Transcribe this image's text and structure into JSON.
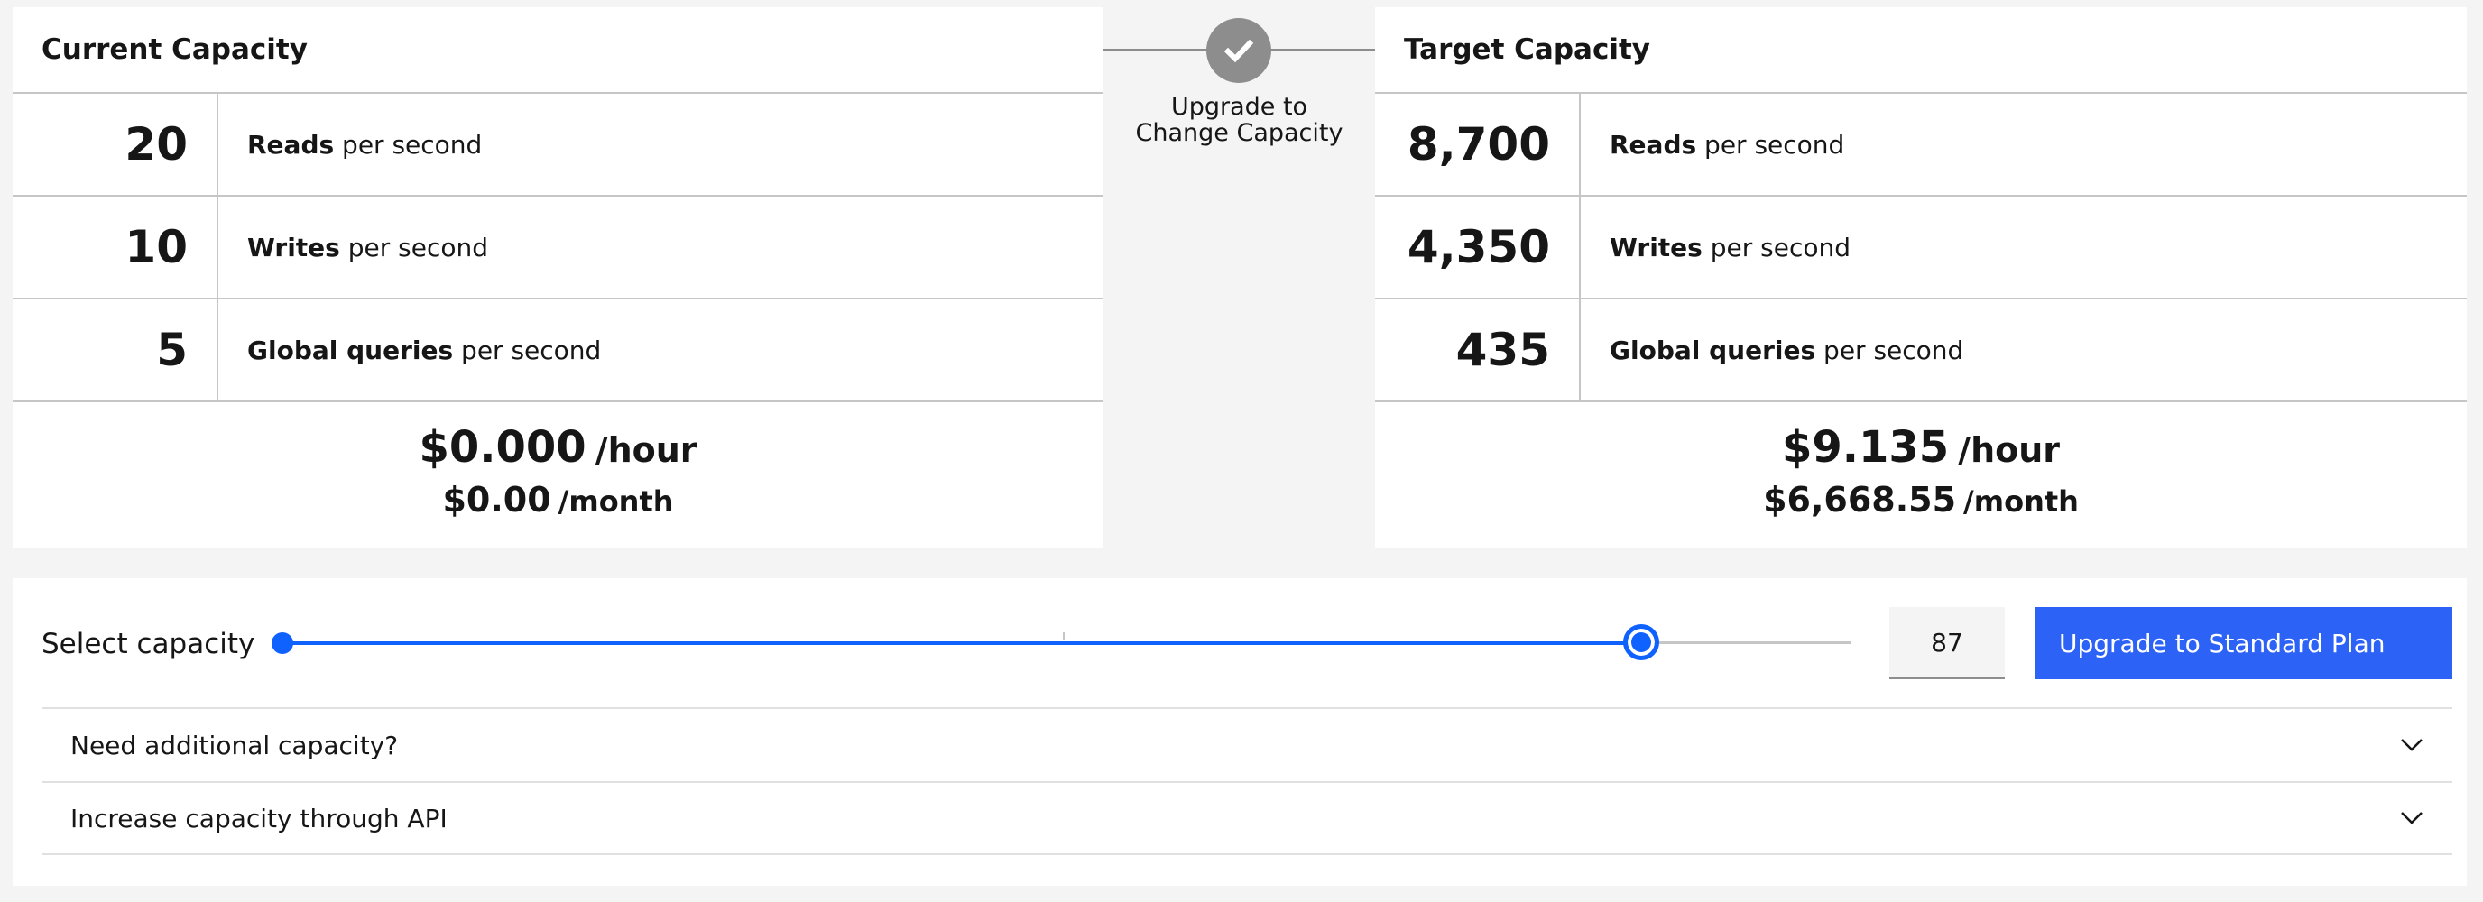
{
  "current": {
    "title": "Current Capacity",
    "rows": [
      {
        "value": "20",
        "label_bold": "Reads",
        "label_rest": " per second"
      },
      {
        "value": "10",
        "label_bold": "Writes",
        "label_rest": " per second"
      },
      {
        "value": "5",
        "label_bold": "Global queries",
        "label_rest": " per second"
      }
    ],
    "hour_price": "$0.000",
    "hour_unit": "/hour",
    "month_price": "$0.00",
    "month_unit": "/month"
  },
  "connector": {
    "line1": "Upgrade to",
    "line2": "Change Capacity",
    "icon": "checkmark-icon"
  },
  "target": {
    "title": "Target Capacity",
    "rows": [
      {
        "value": "8,700",
        "label_bold": "Reads",
        "label_rest": " per second"
      },
      {
        "value": "4,350",
        "label_bold": "Writes",
        "label_rest": " per second"
      },
      {
        "value": "435",
        "label_bold": "Global queries",
        "label_rest": " per second"
      }
    ],
    "hour_price": "$9.135",
    "hour_unit": "/hour",
    "month_price": "$6,668.55",
    "month_unit": "/month"
  },
  "slider": {
    "label": "Select capacity",
    "value": "87",
    "fraction": 0.866,
    "accent": "#0f62fe"
  },
  "actions": {
    "upgrade_label": "Upgrade to Standard Plan"
  },
  "accordion": {
    "items": [
      {
        "label": "Need additional capacity?",
        "icon": "chevron-down-icon"
      },
      {
        "label": "Increase capacity through API",
        "icon": "chevron-down-icon"
      }
    ]
  }
}
